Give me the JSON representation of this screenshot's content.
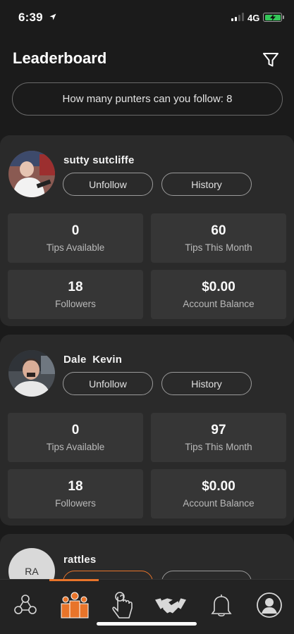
{
  "status_bar": {
    "time": "6:39",
    "network": "4G"
  },
  "header": {
    "title": "Leaderboard"
  },
  "follow_info": "How many punters can you follow: 8",
  "punters": [
    {
      "name": "sutty sutcliffe",
      "follow_label": "Unfollow",
      "history_label": "History",
      "tips_available": "0",
      "tips_available_label": "Tips Available",
      "tips_month": "60",
      "tips_month_label": "Tips This Month",
      "followers": "18",
      "followers_label": "Followers",
      "balance": "$0.00",
      "balance_label": "Account Balance"
    },
    {
      "name": "Dale  Kevin",
      "follow_label": "Unfollow",
      "history_label": "History",
      "tips_available": "0",
      "tips_available_label": "Tips Available",
      "tips_month": "97",
      "tips_month_label": "Tips This Month",
      "followers": "18",
      "followers_label": "Followers",
      "balance": "$0.00",
      "balance_label": "Account Balance"
    },
    {
      "name": "rattles",
      "initials": "RA"
    }
  ],
  "tabs": [
    "network-icon",
    "leaderboard-icon",
    "tap-icon",
    "handshake-icon",
    "bell-icon",
    "profile-icon"
  ],
  "colors": {
    "accent": "#e8742a",
    "background": "#1b1b1b",
    "card": "#2a2a2a",
    "stat_tile": "#363636"
  }
}
